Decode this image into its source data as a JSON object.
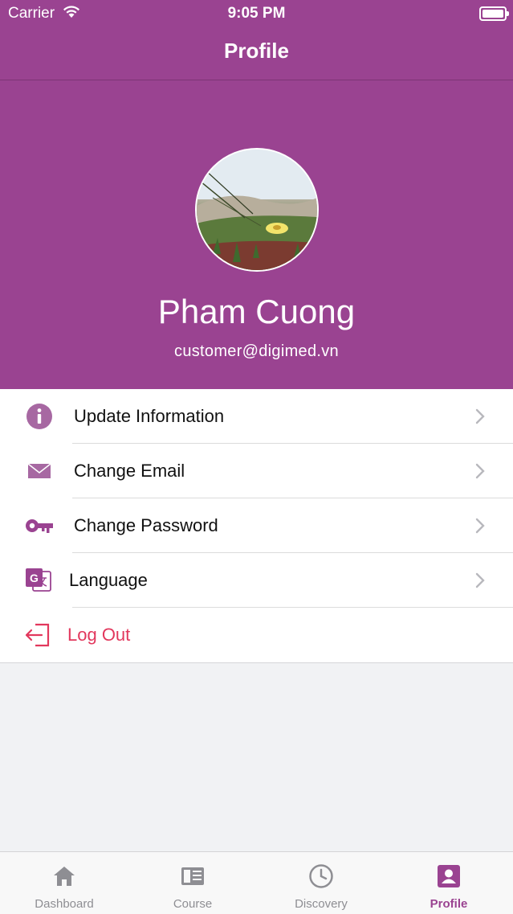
{
  "status_bar": {
    "carrier": "Carrier",
    "time": "9:05 PM"
  },
  "nav": {
    "title": "Profile"
  },
  "profile": {
    "name": "Pham Cuong",
    "email": "customer@digimed.vn"
  },
  "menu": {
    "items": [
      {
        "label": "Update Information",
        "icon": "info-icon"
      },
      {
        "label": "Change Email",
        "icon": "mail-icon"
      },
      {
        "label": "Change Password",
        "icon": "key-icon"
      },
      {
        "label": "Language",
        "icon": "translate-icon"
      },
      {
        "label": "Log Out",
        "icon": "logout-icon"
      }
    ]
  },
  "tabs": [
    {
      "label": "Dashboard",
      "icon": "home-icon",
      "active": false
    },
    {
      "label": "Course",
      "icon": "book-icon",
      "active": false
    },
    {
      "label": "Discovery",
      "icon": "clock-icon",
      "active": false
    },
    {
      "label": "Profile",
      "icon": "profile-icon",
      "active": true
    }
  ],
  "colors": {
    "brand": "#9a4391",
    "logout": "#e2385d",
    "tab_inactive": "#8e8e93"
  }
}
